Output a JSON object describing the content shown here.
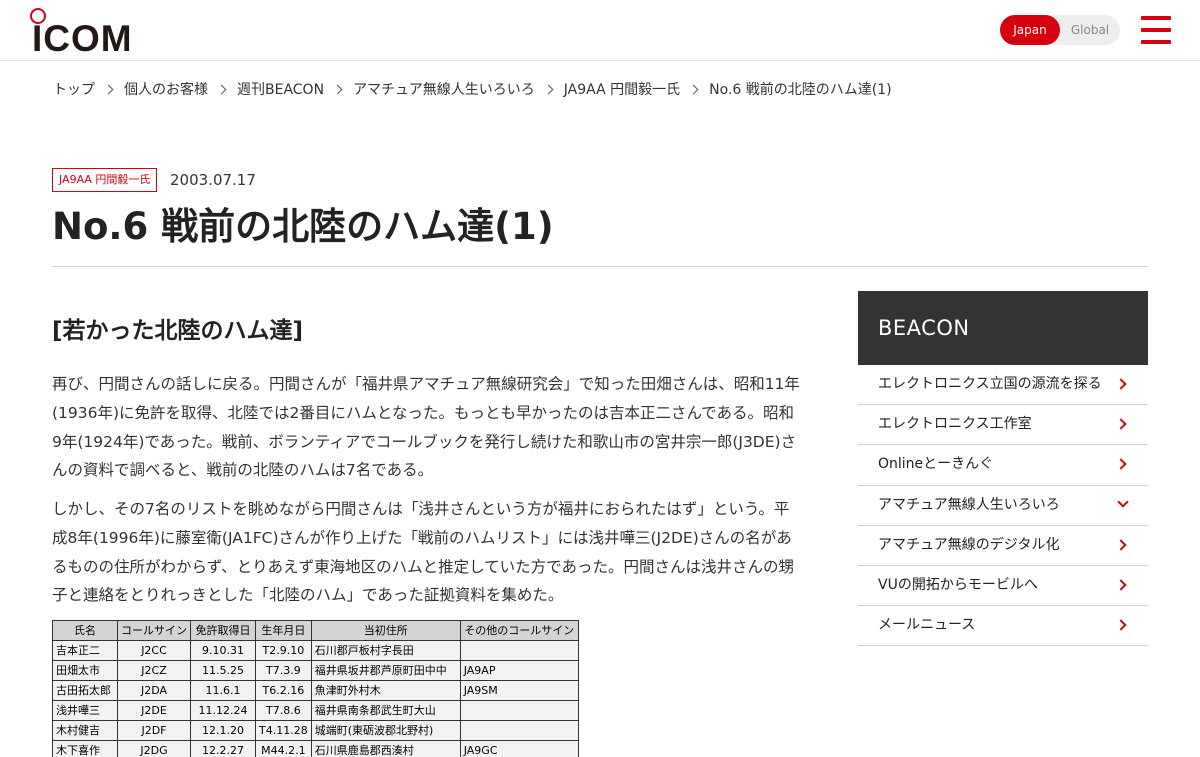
{
  "header": {
    "logo_text": "ICOM",
    "lang_japan": "Japan",
    "lang_global": "Global",
    "accent_color": "#d7000f"
  },
  "breadcrumb": [
    "トップ",
    "個人のお客様",
    "週刊BEACON",
    "アマチュア無線人生いろいろ",
    "JA9AA 円間毅一氏",
    "No.6 戦前の北陸のハム達(1)"
  ],
  "article": {
    "tag": "JA9AA 円間毅一氏",
    "date": "2003.07.17",
    "title": "No.6 戦前の北陸のハム達(1)",
    "section_heading": "[若かった北陸のハム達]",
    "paragraphs": [
      "再び、円間さんの話しに戻る。円間さんが「福井県アマチュア無線研究会」で知った田畑さんは、昭和11年(1936年)に免許を取得、北陸では2番目にハムとなった。もっとも早かったのは吉本正二さんである。昭和9年(1924年)であった。戦前、ボランティアでコールブックを発行し続けた和歌山市の宮井宗一郎(J3DE)さんの資料で調べると、戦前の北陸のハムは7名である。",
      "しかし、その7名のリストを眺めながら円間さんは「浅井さんという方が福井におられたはず」という。平成8年(1996年)に藤室衛(JA1FC)さんが作り上げた「戦前のハムリスト」には浅井嘩三(J2DE)さんの名があるものの住所がわからず、とりあえず東海地区のハムと推定していた方であった。円間さんは浅井さんの甥子と連絡をとりれっきとした「北陸のハム」であった証拠資料を集めた。"
    ]
  },
  "ham_table": {
    "headers": [
      "氏名",
      "コールサイン",
      "免許取得日",
      "生年月日",
      "当初住所",
      "その他のコールサイン"
    ],
    "rows": [
      [
        "吉本正二",
        "J2CC",
        "9.10.31",
        "T2.9.10",
        "石川郡戸板村字長田",
        ""
      ],
      [
        "田畑太市",
        "J2CZ",
        "11.5.25",
        "T7.3.9",
        "福井県坂井郡芦原町田中中",
        "JA9AP"
      ],
      [
        "古田拓太郎",
        "J2DA",
        "11.6.1",
        "T6.2.16",
        "魚津町外村木",
        "JA9SM"
      ],
      [
        "浅井嘩三",
        "J2DE",
        "11.12.24",
        "T7.8.6",
        "福井県南条郡武生町大山",
        ""
      ],
      [
        "木村健吉",
        "J2DF",
        "12.1.20",
        "T4.11.28",
        "城端町(東砺波郡北野村)",
        ""
      ],
      [
        "木下喜作",
        "J2DG",
        "12.2.27",
        "M44.2.1",
        "石川県鹿島郡西湊村",
        "JA9GC"
      ]
    ]
  },
  "sidebar": {
    "title": "BEACON",
    "items": [
      {
        "label": "エレクトロニクス立国の源流を探る",
        "arrow": "right"
      },
      {
        "label": "エレクトロニクス工作室",
        "arrow": "right"
      },
      {
        "label": "Onlineとーきんぐ",
        "arrow": "right"
      },
      {
        "label": "アマチュア無線人生いろいろ",
        "arrow": "down"
      },
      {
        "label": "アマチュア無線のデジタル化",
        "arrow": "right"
      },
      {
        "label": "VUの開拓からモービルへ",
        "arrow": "right"
      },
      {
        "label": "メールニュース",
        "arrow": "right"
      }
    ]
  }
}
